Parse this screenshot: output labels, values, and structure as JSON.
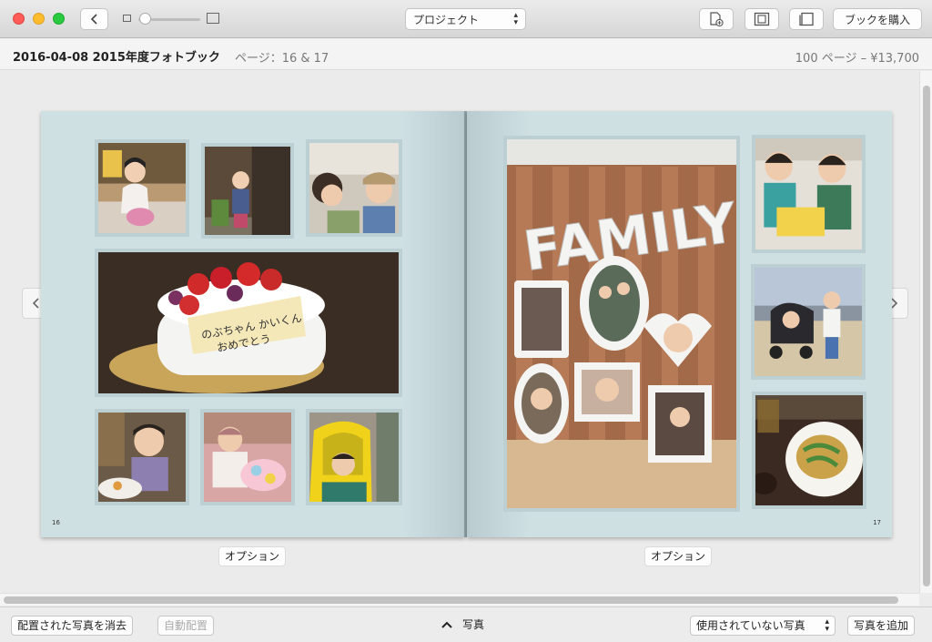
{
  "toolbar": {
    "project_select": "プロジェクト",
    "buy_button": "ブックを購入",
    "icons": [
      "chevron-left-icon",
      "small-photo-icon",
      "large-photo-icon",
      "add-page-icon",
      "layout-icon",
      "cover-icon"
    ]
  },
  "info": {
    "title": "2016-04-08 2015年度フォトブック",
    "page_label": "ページ：16 & 17",
    "price": "100 ページ – ¥13,700"
  },
  "book": {
    "left_page_number": "16",
    "right_page_number": "17",
    "options_label": "オプション",
    "cake_text_line1": "のぶちゃん かいくん",
    "cake_text_line2": "おめでとう",
    "family_sign": "FAMILY"
  },
  "bottom": {
    "clear_button": "配置された写真を消去",
    "autofill_button": "自動配置",
    "photos_toggle": "写真",
    "unused_select": "使用されていない写真",
    "add_photos_button": "写真を追加"
  },
  "colors": {
    "page_background": "#cfdfe2",
    "photo_border": "#bccfd3"
  }
}
